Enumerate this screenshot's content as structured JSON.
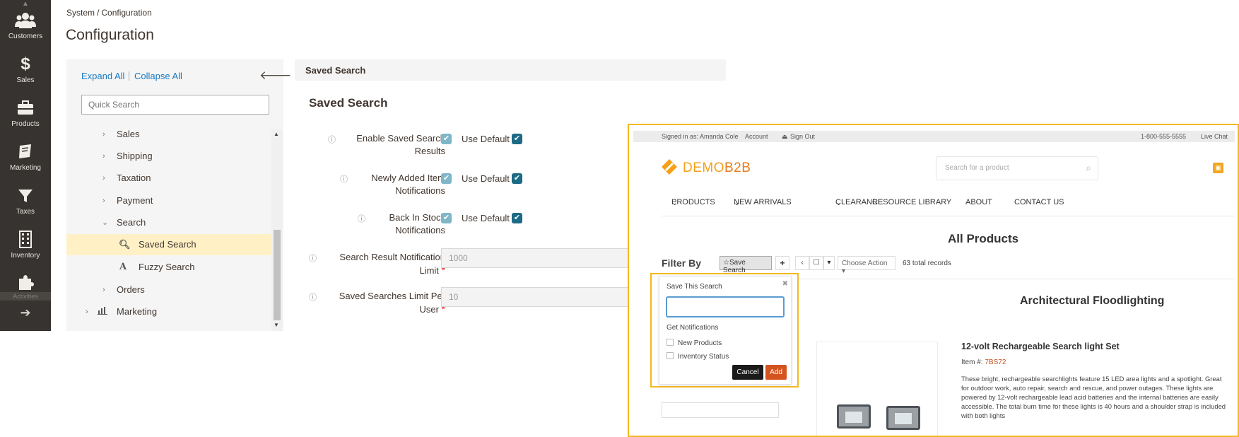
{
  "rail": {
    "items": [
      {
        "label": "Customers",
        "icon": "customers-icon"
      },
      {
        "label": "Sales",
        "icon": "dollar-icon"
      },
      {
        "label": "Products",
        "icon": "box-icon"
      },
      {
        "label": "Marketing",
        "icon": "megaphone-icon"
      },
      {
        "label": "Taxes",
        "icon": "filter-icon"
      },
      {
        "label": "Inventory",
        "icon": "building-icon"
      },
      {
        "label": "Activities",
        "icon": "puzzle-icon"
      }
    ],
    "activities_label": "Activities"
  },
  "breadcrumb": {
    "parent": "System",
    "sep": "/",
    "current": "Configuration"
  },
  "page_title": "Configuration",
  "sidebar": {
    "expand_all": "Expand All",
    "collapse_all": "Collapse All",
    "search_placeholder": "Quick Search",
    "items": [
      {
        "label": "Sales"
      },
      {
        "label": "Shipping"
      },
      {
        "label": "Taxation"
      },
      {
        "label": "Payment"
      },
      {
        "label": "Search"
      },
      {
        "label": "Saved Search"
      },
      {
        "label": "Fuzzy Search"
      },
      {
        "label": "Orders"
      },
      {
        "label": "Marketing"
      }
    ]
  },
  "section": {
    "bar_title": "Saved Search",
    "title": "Saved Search",
    "use_default": "Use Default",
    "fields": [
      {
        "label_1": "Enable Saved Search",
        "label_2": "Results"
      },
      {
        "label_1": "Newly Added Item",
        "label_2": "Notifications"
      },
      {
        "label_1": "Back In Stock",
        "label_2": "Notifications"
      },
      {
        "label_1": "Search Result Notification",
        "label_2": "Limit",
        "value": "1000"
      },
      {
        "label_1": "Saved Searches Limit Per",
        "label_2": "User",
        "value": "10"
      }
    ]
  },
  "store": {
    "signed_in": "Signed in as: Amanda Cole",
    "account": "Account",
    "sign_out": "Sign Out",
    "phone": "1-800-555-5555",
    "live_chat": "Live Chat",
    "logo_demo": "DEMO",
    "logo_b2b": "B2B",
    "search_placeholder": "Search for a product",
    "nav": [
      "PRODUCTS",
      "NEW ARRIVALS",
      "CLEARANCE",
      "RESOURCE LIBRARY",
      "ABOUT",
      "CONTACT US"
    ],
    "all_products": "All Products",
    "filter_by": "Filter By",
    "save_search": "Save Search",
    "choose_action": "Choose Action",
    "total_records": "63 total records",
    "category_title": "Architectural Floodlighting",
    "product": {
      "name": "12-volt Rechargeable Search light Set",
      "item_label": "Item #:",
      "item_code": "7BS72",
      "description": "These bright, rechargeable searchlights feature 15 LED area lights and a spotlight. Great for outdoor work, auto repair, search and rescue, and power outages. These lights are powered by 12-volt rechargeable lead acid batteries and the internal batteries are easily accessible. The total burn time for these lights is 40 hours and a shoulder strap is included with both lights"
    },
    "popup": {
      "title": "Save This Search",
      "get_notifications": "Get Notifications",
      "options": [
        "New Products",
        "Inventory Status"
      ],
      "cancel": "Cancel",
      "add": "Add"
    }
  },
  "colors": {
    "rail_bg": "#373330",
    "link": "#1979c3",
    "highlight": "#fff1c5",
    "overlay_border": "#f5b81f",
    "add_button": "#d4541f"
  }
}
